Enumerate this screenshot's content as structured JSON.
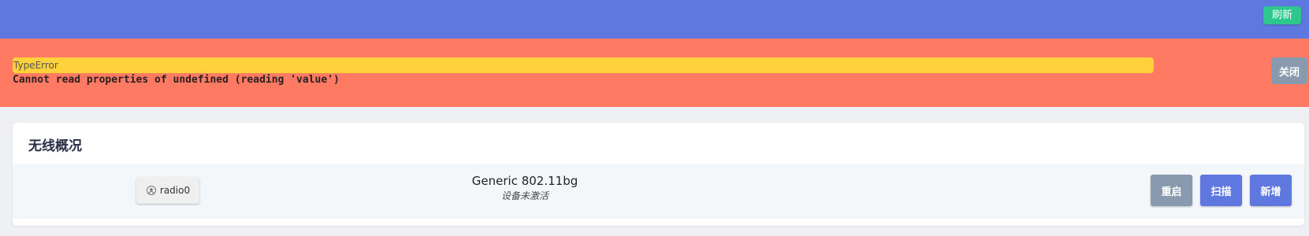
{
  "header": {
    "refresh_label": "刷新"
  },
  "error": {
    "title": "TypeError",
    "message": "Cannot read properties of undefined (reading 'value')",
    "close_label": "关闭"
  },
  "wireless": {
    "title": "无线概况",
    "radio": {
      "name": "radio0",
      "icon": "wifi-signal-icon",
      "model": "Generic 802.11bg",
      "status": "设备未激活"
    },
    "actions": {
      "restart_label": "重启",
      "scan_label": "扫描",
      "add_label": "新增"
    }
  },
  "colors": {
    "header_bg": "#5e78e0",
    "error_bg": "#ff7a63",
    "error_title_bg": "#ffd13a",
    "refresh": "#2ec78e",
    "neutral_button": "#8a9aae",
    "primary_button": "#5e78e0"
  }
}
